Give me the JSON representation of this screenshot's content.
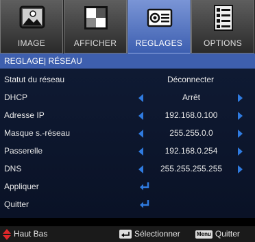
{
  "tabs": [
    {
      "label": "IMAGE",
      "icon": "picture-icon"
    },
    {
      "label": "AFFICHER",
      "icon": "display-icon"
    },
    {
      "label": "REGLAGES",
      "icon": "projector-icon"
    },
    {
      "label": "OPTIONS",
      "icon": "options-list-icon"
    }
  ],
  "section_title": "REGLAGE| RÉSEAU",
  "rows": [
    {
      "name": "Statut du réseau",
      "value": "Déconnecter"
    },
    {
      "name": "DHCP",
      "value": "Arrêt"
    },
    {
      "name": "Adresse IP",
      "value": "192.168.0.100"
    },
    {
      "name": "Masque s.-réseau",
      "value": "255.255.0.0"
    },
    {
      "name": "Passerelle",
      "value": "192.168.0.254"
    },
    {
      "name": "DNS",
      "value": "255.255.255.255"
    },
    {
      "name": "Appliquer"
    },
    {
      "name": "Quitter"
    }
  ],
  "footer": {
    "nav_label": "Haut Bas",
    "select_label": "Sélectionner",
    "menu_key": "Menu",
    "quit_label": "Quitter"
  },
  "colors": {
    "accent": "#3e5fae",
    "arrow": "#2f7be0",
    "nav_arrow": "#e0282a"
  }
}
